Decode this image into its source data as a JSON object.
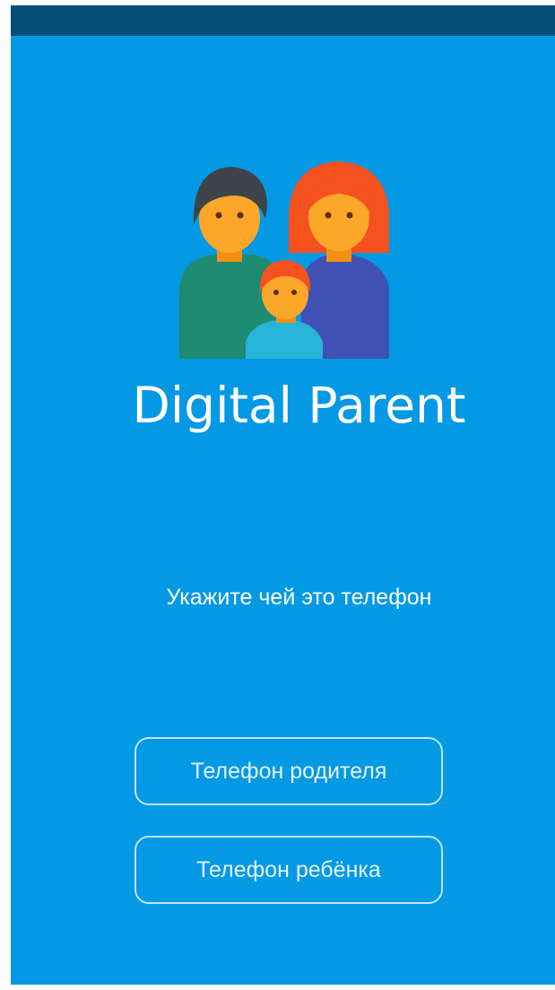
{
  "app": {
    "name": "Digital Parent"
  },
  "prompt": "Укажите чей это телефон",
  "buttons": {
    "parent_phone": "Телефон родителя",
    "child_phone": "Телефон ребёнка"
  },
  "icons": {
    "logo": "family-icon"
  },
  "colors": {
    "background": "#0399e4",
    "status_bar": "#05507a",
    "text": "#ffffff"
  }
}
